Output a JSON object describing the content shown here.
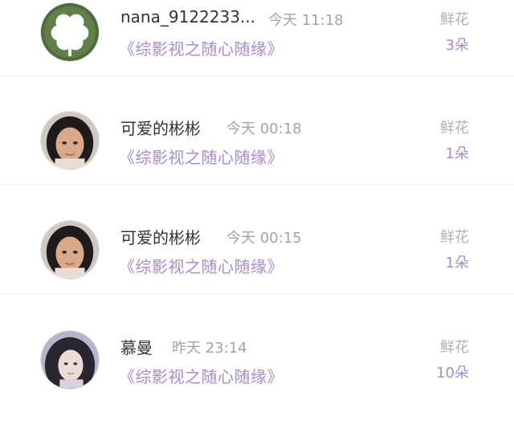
{
  "comments": [
    {
      "username": "nana_9122233...",
      "time": "今天 11:18",
      "work": "《综影视之随心随缘》",
      "gift_label": "鲜花",
      "gift_count": "3朵",
      "avatar_icon": "clover-avatar-icon"
    },
    {
      "username": "可爱的彬彬",
      "time": "今天 00:18",
      "work": "《综影视之随心随缘》",
      "gift_label": "鲜花",
      "gift_count": "1朵",
      "avatar_icon": "girl-photo-avatar-icon"
    },
    {
      "username": "可爱的彬彬",
      "time": "今天 00:15",
      "work": "《综影视之随心随缘》",
      "gift_label": "鲜花",
      "gift_count": "1朵",
      "avatar_icon": "girl-photo-avatar-icon"
    },
    {
      "username": "慕曼",
      "time": "昨天 23:14",
      "work": "《综影视之随心随缘》",
      "gift_label": "鲜花",
      "gift_count": "10朵",
      "avatar_icon": "girl-portrait-avatar-icon"
    }
  ],
  "colors": {
    "accent_purple": "#a88bce",
    "name_text": "#333333",
    "meta_gray": "#a3a3a3"
  }
}
